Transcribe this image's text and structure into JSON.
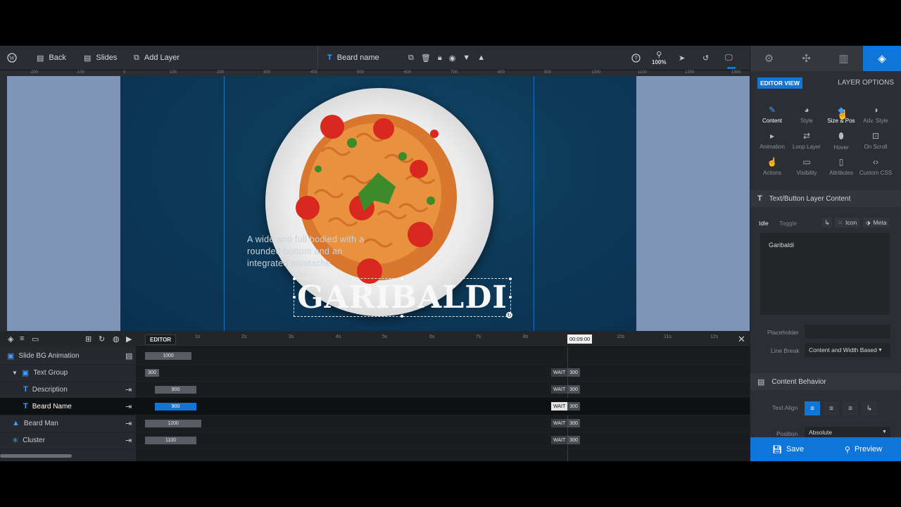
{
  "toolbar": {
    "back": "Back",
    "slides": "Slides",
    "add_layer": "Add Layer",
    "layer_name": "Beard name",
    "zoom": "100%"
  },
  "ruler": {
    "ticks": [
      "-200",
      "-100",
      "0",
      "100",
      "200",
      "300",
      "400",
      "500",
      "600",
      "700",
      "800",
      "900",
      "1000",
      "1100",
      "1200",
      "1300"
    ]
  },
  "canvas": {
    "description": "A wide and full bodied with a rounded bottom and an integrated mustache",
    "title": "GARIBALDI"
  },
  "timeline": {
    "editor_label": "EDITOR",
    "seconds": [
      "1s",
      "2s",
      "3s",
      "4s",
      "5s",
      "6s",
      "7s",
      "8s",
      "10s",
      "11s",
      "12s"
    ],
    "current_time": "00:09:00",
    "rows": [
      {
        "label": "Slide BG Animation",
        "value": "1000",
        "wait": "",
        "end": ""
      },
      {
        "label": "Text Group",
        "value": "300",
        "wait": "WAIT",
        "end": "300"
      },
      {
        "label": "Description",
        "value": "900",
        "wait": "WAIT",
        "end": "300"
      },
      {
        "label": "Beard Name",
        "value": "900",
        "wait": "WAIT",
        "end": "300"
      },
      {
        "label": "Beard Man",
        "value": "1200",
        "wait": "WAIT",
        "end": "300"
      },
      {
        "label": "Cluster",
        "value": "1100",
        "wait": "WAIT",
        "end": "300"
      }
    ]
  },
  "panel": {
    "editor_view": "EDITOR VIEW",
    "layer_options": "LAYER OPTIONS",
    "options": [
      {
        "label": "Content",
        "icon": "pencil-icon"
      },
      {
        "label": "Style",
        "icon": "palette-icon"
      },
      {
        "label": "Size & Pos",
        "icon": "resize-icon"
      },
      {
        "label": "Adv. Style",
        "icon": "contrast-icon"
      },
      {
        "label": "Animation",
        "icon": "play-icon"
      },
      {
        "label": "Loop Layer",
        "icon": "loop-icon"
      },
      {
        "label": "Hover",
        "icon": "mouse-icon"
      },
      {
        "label": "On Scroll",
        "icon": "scroll-icon"
      },
      {
        "label": "Actions",
        "icon": "hand-icon"
      },
      {
        "label": "Visibility",
        "icon": "monitor-icon"
      },
      {
        "label": "Attributes",
        "icon": "file-icon"
      },
      {
        "label": "Custom CSS",
        "icon": "code-icon"
      }
    ],
    "content_section": "Text/Button Layer Content",
    "idle": "Idle",
    "toggle": "Toggle",
    "icon_btn": "Icon",
    "meta_btn": "Meta",
    "text_value": "Garibaldi",
    "placeholder_label": "Placeholder",
    "line_break_label": "Line Break",
    "line_break_value": "Content and Width Based",
    "behavior_section": "Content Behavior",
    "text_align_label": "Text Align",
    "position_label": "Position",
    "position_value": "Absolute",
    "save": "Save",
    "preview": "Preview"
  },
  "colors": {
    "accent": "#0f75d9",
    "slide_bg": "#0d3a59",
    "canvas_bg": "#7e95b8"
  }
}
